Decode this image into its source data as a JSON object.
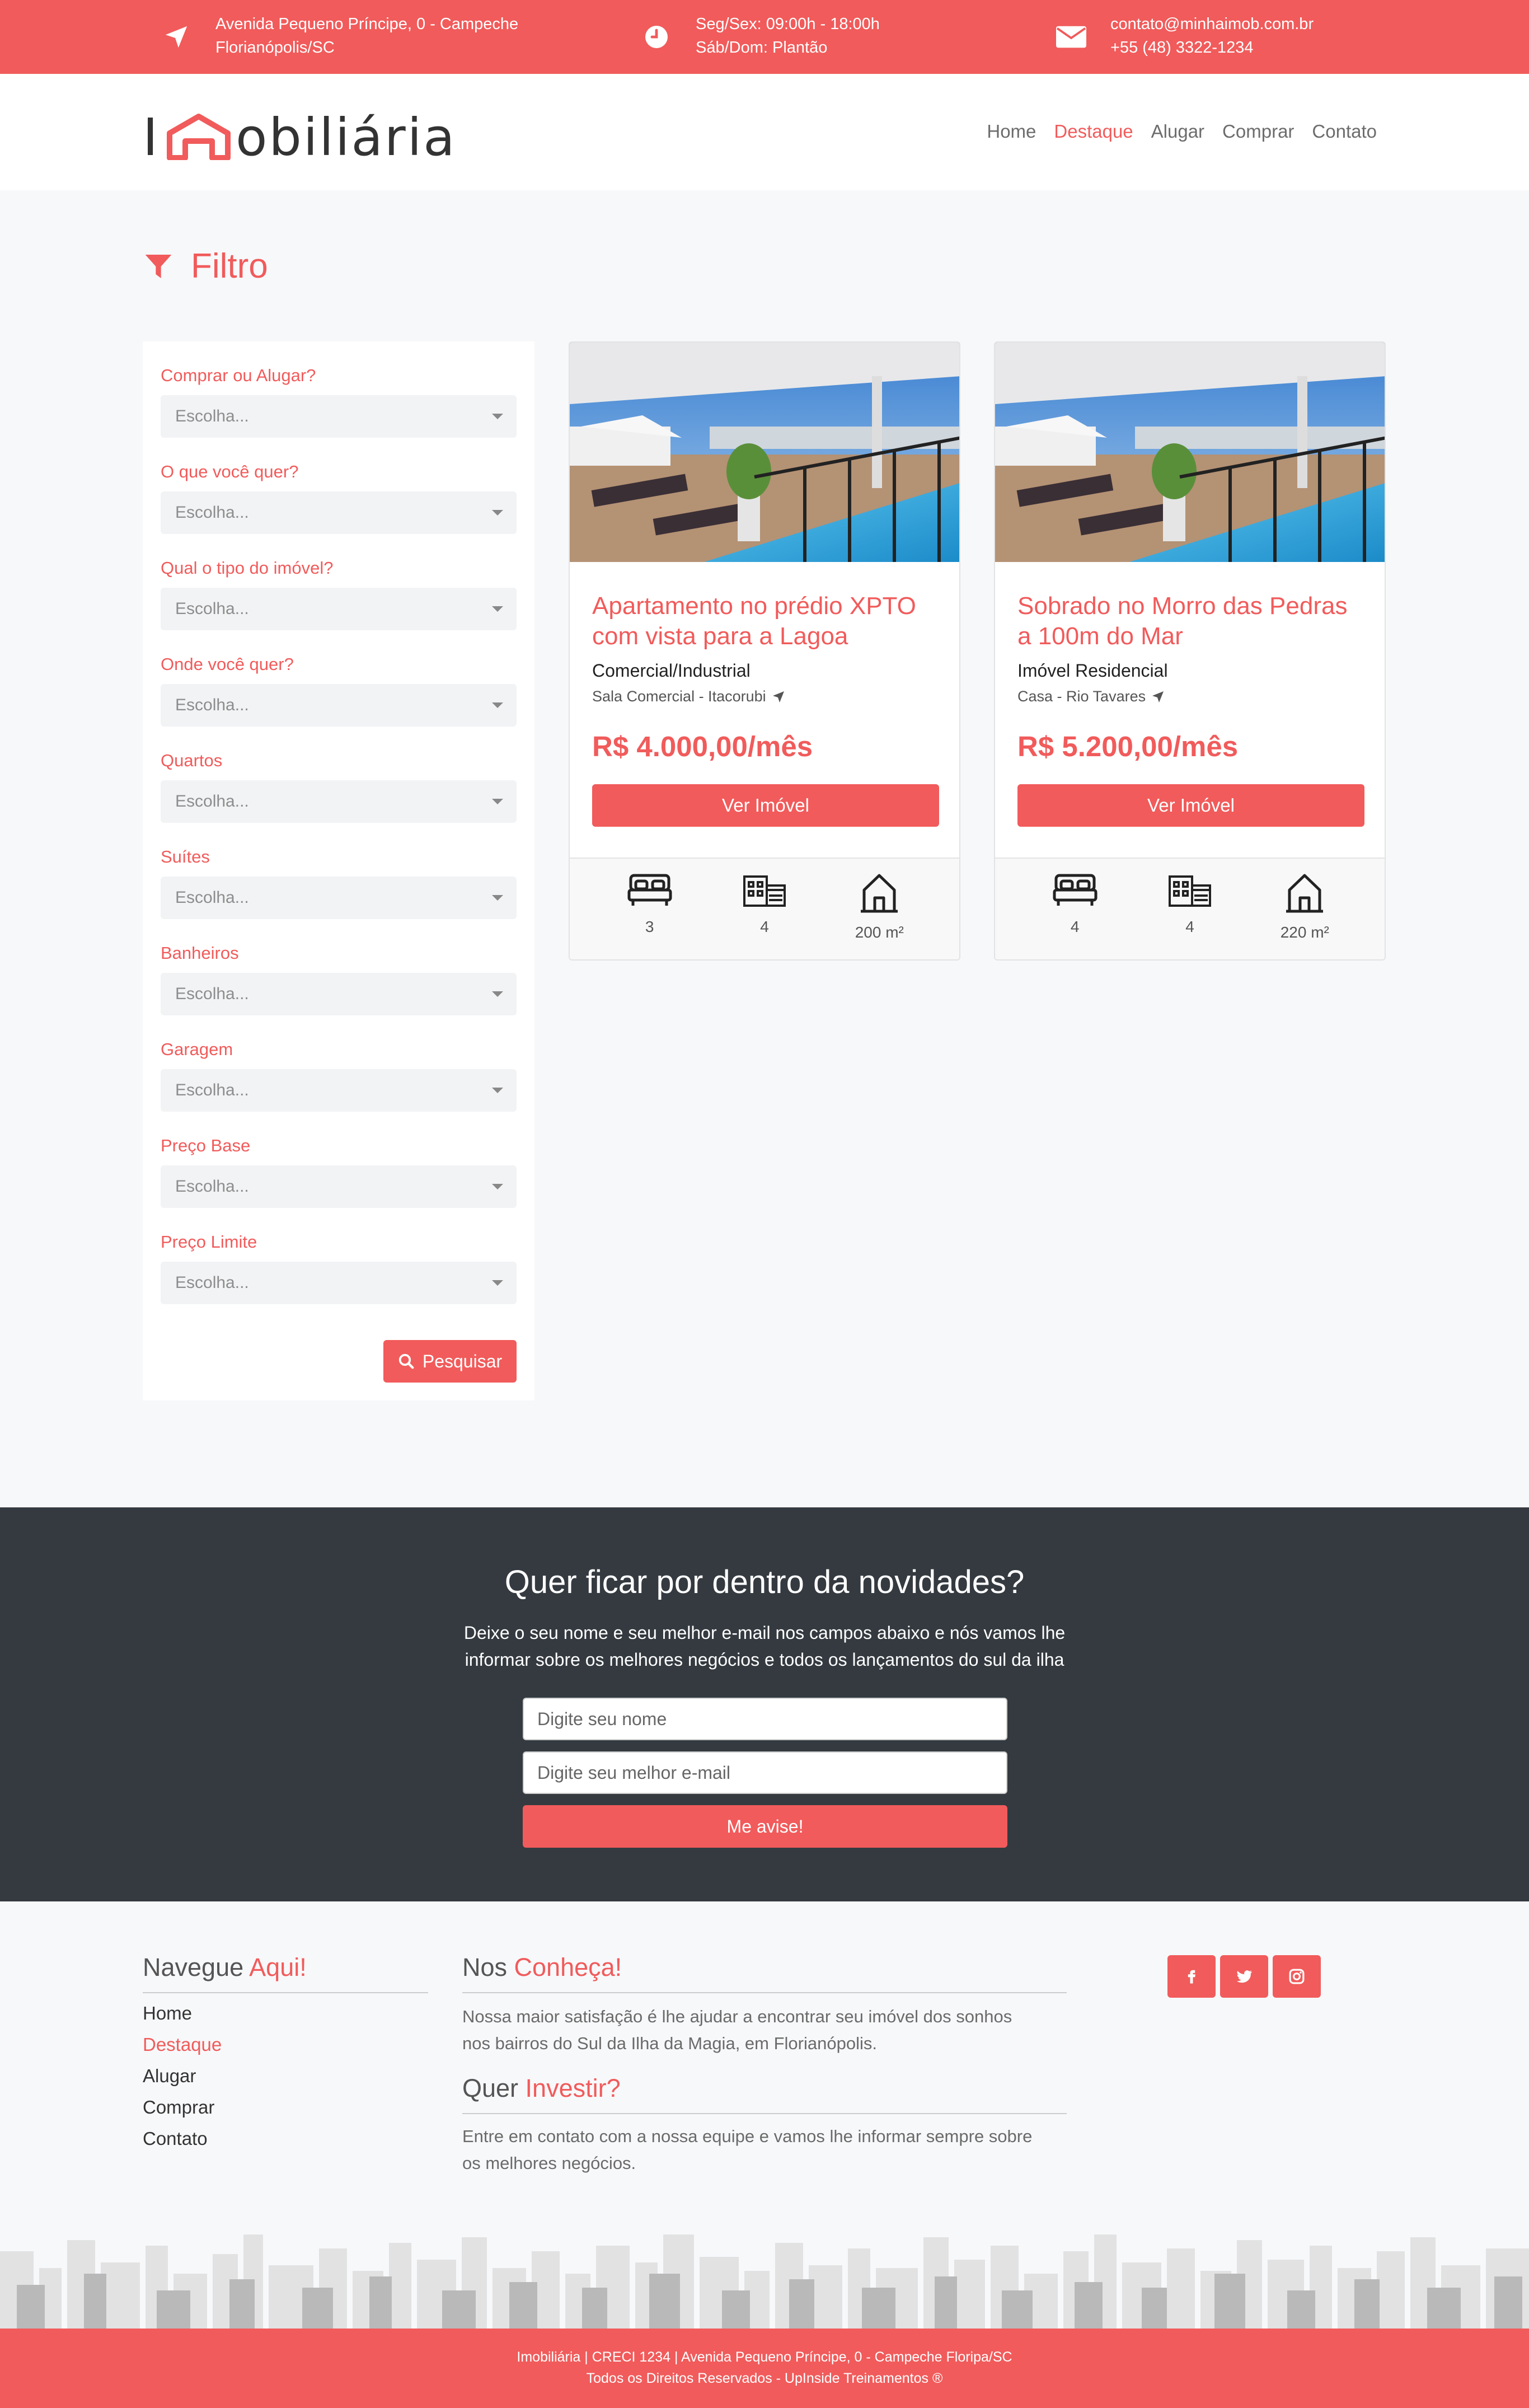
{
  "topbar": {
    "address_line1": "Avenida Pequeno Príncipe, 0 - Campeche",
    "address_line2": "Florianópolis/SC",
    "hours_line1": "Seg/Sex: 09:00h - 18:00h",
    "hours_line2": "Sáb/Dom: Plantão",
    "email": "contato@minhaimob.com.br",
    "phone": "+55 (48) 3322-1234"
  },
  "logo": {
    "prefix": "I",
    "suffix": "obiliária"
  },
  "nav": {
    "items": [
      {
        "label": "Home"
      },
      {
        "label": "Destaque"
      },
      {
        "label": "Alugar"
      },
      {
        "label": "Comprar"
      },
      {
        "label": "Contato"
      }
    ],
    "active": "Destaque"
  },
  "filter": {
    "title": "Filtro",
    "fields": [
      {
        "label": "Comprar ou Alugar?",
        "value": "Escolha..."
      },
      {
        "label": "O que você quer?",
        "value": "Escolha..."
      },
      {
        "label": "Qual o tipo do imóvel?",
        "value": "Escolha..."
      },
      {
        "label": "Onde você quer?",
        "value": "Escolha..."
      },
      {
        "label": "Quartos",
        "value": "Escolha..."
      },
      {
        "label": "Suítes",
        "value": "Escolha..."
      },
      {
        "label": "Banheiros",
        "value": "Escolha..."
      },
      {
        "label": "Garagem",
        "value": "Escolha..."
      },
      {
        "label": "Preço Base",
        "value": "Escolha..."
      },
      {
        "label": "Preço Limite",
        "value": "Escolha..."
      }
    ],
    "search_label": "Pesquisar"
  },
  "cards": [
    {
      "title": "Apartamento no prédio XPTO com vista para a Lagoa",
      "category": "Comercial/Industrial",
      "location": "Sala Comercial - Itacorubi",
      "price": "R$ 4.000,00/mês",
      "button": "Ver Imóvel",
      "bedrooms": "3",
      "garage": "4",
      "area": "200 m²"
    },
    {
      "title": "Sobrado no Morro das Pedras a 100m do Mar",
      "category": "Imóvel Residencial",
      "location": "Casa - Rio Tavares",
      "price": "R$ 5.200,00/mês",
      "button": "Ver Imóvel",
      "bedrooms": "4",
      "garage": "4",
      "area": "220 m²"
    }
  ],
  "newsletter": {
    "title": "Quer ficar por dentro da novidades?",
    "desc_line1": "Deixe o seu nome e seu melhor e-mail nos campos abaixo e nós vamos lhe",
    "desc_line2": "informar sobre os melhores negócios e todos os lançamentos do sul da ilha",
    "name_placeholder": "Digite seu nome",
    "email_placeholder": "Digite seu melhor e-mail",
    "button": "Me avise!"
  },
  "footer": {
    "nav_title_a": "Navegue ",
    "nav_title_b": "Aqui!",
    "nav_items": [
      "Home",
      "Destaque",
      "Alugar",
      "Comprar",
      "Contato"
    ],
    "about_title_a": "Nos ",
    "about_title_b": "Conheça!",
    "about_text_line1": "Nossa maior satisfação é lhe ajudar a encontrar seu imóvel dos sonhos",
    "about_text_line2": "nos bairros do Sul da Ilha da Magia, em Florianópolis.",
    "invest_title_a": "Quer ",
    "invest_title_b": "Investir?",
    "invest_text_line1": "Entre em contato com a nossa equipe e vamos lhe informar sempre sobre",
    "invest_text_line2": "os melhores negócios.",
    "social": [
      "facebook-icon",
      "twitter-icon",
      "instagram-icon"
    ],
    "bottom_line1": "Imobiliária | CRECI 1234 | Avenida Pequeno Príncipe, 0 - Campeche Floripa/SC",
    "bottom_line2": "Todos os Direitos Reservados - UpInside Treinamentos ®"
  },
  "colors": {
    "brand": "#f15b5b",
    "dark": "#343a40",
    "background": "#f7f8fa"
  }
}
